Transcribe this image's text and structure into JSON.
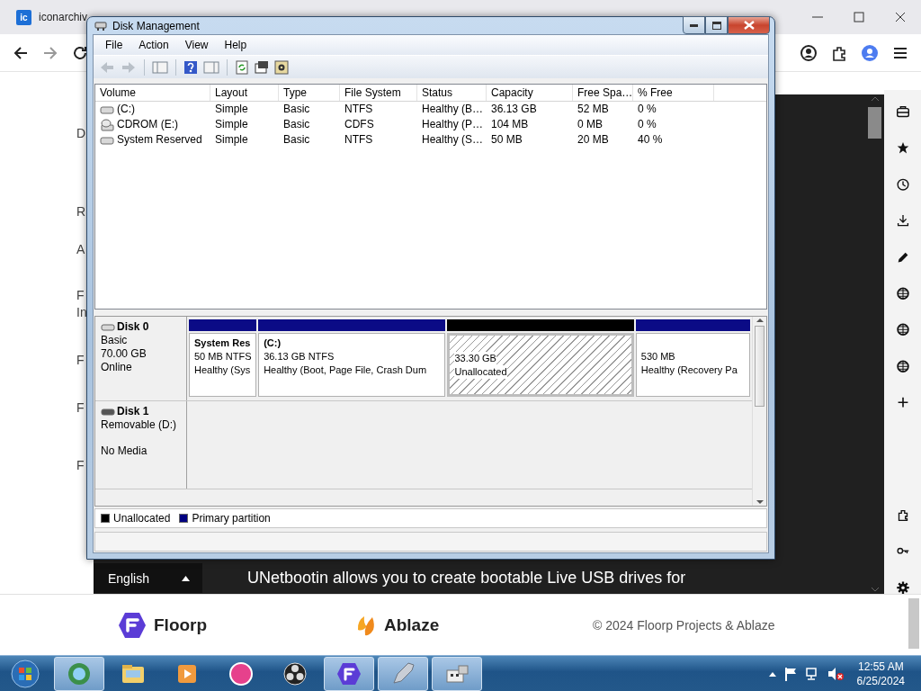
{
  "browser": {
    "tab": {
      "icon_text": "ic",
      "title": "iconarchiv"
    },
    "page_fragments": [
      "D",
      "R",
      "A",
      "F",
      "In",
      "F",
      "F",
      "F"
    ],
    "language_select": {
      "value": "English"
    },
    "banner_text": "UNetbootin allows you to create bootable Live USB drives for",
    "footer": {
      "brands": [
        {
          "name": "Floorp",
          "kind": "floorp"
        },
        {
          "name": "Ablaze",
          "kind": "ablaze"
        }
      ],
      "copyright": "© 2024 Floorp Projects & Ablaze"
    }
  },
  "window": {
    "title": "Disk Management",
    "menu": [
      "File",
      "Action",
      "View",
      "Help"
    ],
    "table": {
      "columns": [
        "Volume",
        "Layout",
        "Type",
        "File System",
        "Status",
        "Capacity",
        "Free Spa…",
        "% Free"
      ],
      "rows": [
        {
          "kind": "disk",
          "cells": [
            "(C:)",
            "Simple",
            "Basic",
            "NTFS",
            "Healthy (B…",
            "36.13 GB",
            "52 MB",
            "0 %"
          ]
        },
        {
          "kind": "cdrom",
          "cells": [
            "CDROM (E:)",
            "Simple",
            "Basic",
            "CDFS",
            "Healthy (P…",
            "104 MB",
            "0 MB",
            "0 %"
          ]
        },
        {
          "kind": "disk",
          "cells": [
            "System Reserved",
            "Simple",
            "Basic",
            "NTFS",
            "Healthy (S…",
            "50 MB",
            "20 MB",
            "40 %"
          ]
        }
      ]
    },
    "disks": [
      {
        "name": "Disk 0",
        "kind": "basic",
        "lines": [
          "Basic",
          "70.00 GB",
          "Online"
        ],
        "partitions": [
          {
            "kind": "primary",
            "name": "System Res",
            "lines": [
              "50 MB NTFS",
              "Healthy (Sys"
            ]
          },
          {
            "kind": "primary",
            "name": "(C:)",
            "lines": [
              "36.13 GB NTFS",
              "Healthy (Boot, Page File, Crash Dum"
            ]
          },
          {
            "kind": "unallocated",
            "lines": [
              "33.30 GB",
              "Unallocated"
            ]
          },
          {
            "kind": "primary",
            "lines": [
              "530 MB",
              "Healthy (Recovery Pa"
            ]
          }
        ]
      },
      {
        "name": "Disk 1",
        "kind": "removable",
        "lines": [
          "Removable (D:)"
        ],
        "note": "No Media"
      }
    ],
    "legend": [
      {
        "label": "Unallocated",
        "color": "#000000"
      },
      {
        "label": "Primary partition",
        "color": "#000080"
      }
    ]
  },
  "taskbar": {
    "time": "12:55 AM",
    "date": "6/25/2024"
  }
}
